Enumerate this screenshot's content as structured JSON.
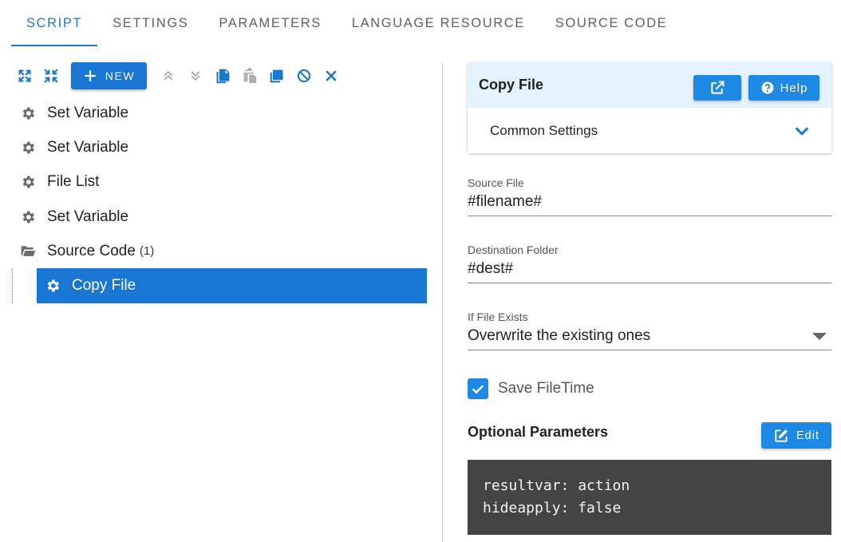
{
  "tabs": [
    {
      "label": "SCRIPT",
      "active": true
    },
    {
      "label": "SETTINGS",
      "active": false
    },
    {
      "label": "PARAMETERS",
      "active": false
    },
    {
      "label": "LANGUAGE RESOURCE",
      "active": false
    },
    {
      "label": "SOURCE CODE",
      "active": false
    }
  ],
  "toolbar": {
    "new_label": "NEW",
    "icons": [
      "expand-all-icon",
      "collapse-all-icon",
      "add-icon",
      "move-up-icon",
      "move-down-icon",
      "copy-icon",
      "paste-icon",
      "duplicate-icon",
      "disable-icon",
      "delete-icon"
    ]
  },
  "tree": {
    "items": [
      {
        "label": "Set Variable",
        "icon": "gear-icon"
      },
      {
        "label": "Set Variable",
        "icon": "gear-icon"
      },
      {
        "label": "File List",
        "icon": "gear-icon"
      },
      {
        "label": "Set Variable",
        "icon": "gear-icon"
      },
      {
        "label": "Source Code",
        "count": "(1)",
        "icon": "folder-open-icon"
      }
    ],
    "selected": {
      "label": "Copy File",
      "icon": "gear-icon"
    }
  },
  "panel": {
    "title": "Copy File",
    "help_label": "Help",
    "common_settings_label": "Common Settings",
    "source_file": {
      "label": "Source File",
      "value": "#filename#"
    },
    "destination_folder": {
      "label": "Destination Folder",
      "value": "#dest#"
    },
    "if_file_exists": {
      "label": "If File Exists",
      "value": "Overwrite the existing ones"
    },
    "save_filetime": {
      "label": "Save FileTime",
      "checked": true
    },
    "optional_parameters_title": "Optional Parameters",
    "edit_label": "Edit",
    "code_lines": [
      "resultvar: action",
      "hideapply: false"
    ]
  },
  "colors": {
    "accent": "#1976d2",
    "button": "#1e88e5",
    "header_bg": "#e3f2fd",
    "code_bg": "#444444",
    "icon_disabled": "#b0b0b0"
  }
}
